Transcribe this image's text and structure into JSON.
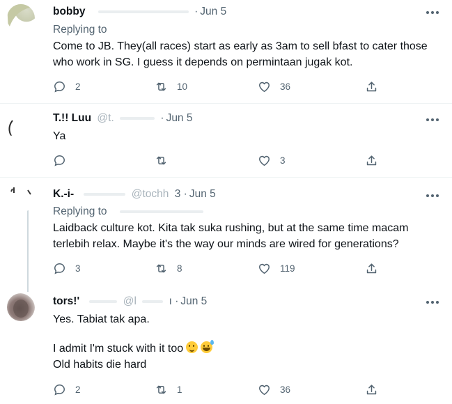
{
  "tweets": [
    {
      "name": "bobby",
      "handle": "",
      "sep": "·",
      "date": "Jun 5",
      "replying_label": "Replying to",
      "replying_to": "",
      "lines": [
        "Come to JB. They(all races) start as early as 3am to sell bfast to cater those",
        "who work in SG. I guess it depends on permintaan jugak kot."
      ],
      "replies": "2",
      "retweets": "10",
      "likes": "36"
    },
    {
      "name": "T.!! Luu",
      "handle": "@t.",
      "sep": "·",
      "date": "Jun 5",
      "lines": [
        "Ya"
      ],
      "replies": "",
      "retweets": "",
      "likes": "3"
    },
    {
      "name": "K.-i-",
      "handle": "@tochh",
      "sep": "3 ·",
      "date": "Jun 5",
      "replying_label": "Replying to",
      "replying_to": "",
      "lines": [
        "Laidback culture kot. Kita tak suka rushing, but at the same time macam",
        "terlebih relax. Maybe it's the way our minds are wired for generations?"
      ],
      "replies": "3",
      "retweets": "8",
      "likes": "119"
    },
    {
      "name": "tors!'",
      "handle": "@l",
      "sep": "ı ·",
      "date": "Jun 5",
      "lines": [
        "Yes. Tabiat tak apa."
      ],
      "extra_line_1": "I admit I'm stuck with it too",
      "extra_line_2": "Old habits die hard",
      "replies": "2",
      "retweets": "1",
      "likes": "36"
    }
  ],
  "icons": {
    "more": "more-icon",
    "reply": "reply-icon",
    "retweet": "retweet-icon",
    "like": "heart-icon",
    "share": "share-icon"
  },
  "colors": {
    "text": "#0f1419",
    "secondary": "#536471",
    "divider": "#eff3f4"
  }
}
